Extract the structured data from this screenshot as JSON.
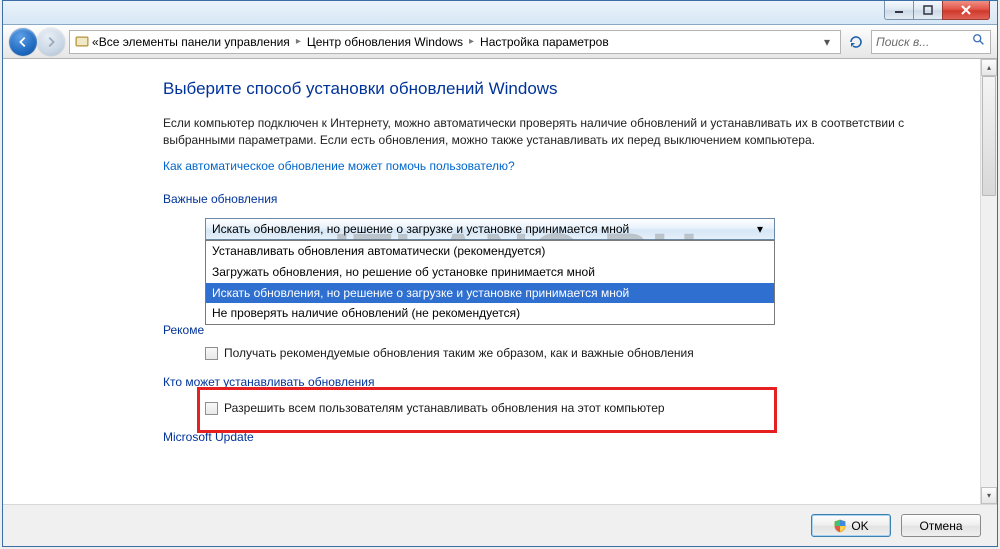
{
  "watermark": "ITLANG.RU",
  "breadcrumb": {
    "prefix": "«",
    "items": [
      "Все элементы панели управления",
      "Центр обновления Windows",
      "Настройка параметров"
    ]
  },
  "search": {
    "placeholder": "Поиск в..."
  },
  "page": {
    "title": "Выберите способ установки обновлений Windows",
    "intro": "Если компьютер подключен к Интернету, можно автоматически проверять наличие обновлений и устанавливать их в соответствии с выбранными параметрами. Если есть обновления, можно также устанавливать их перед выключением компьютера.",
    "help_link": "Как автоматическое обновление может помочь пользователю?"
  },
  "important": {
    "label": "Важные обновления",
    "selected": "Искать обновления, но решение о загрузке и установке принимается мной",
    "options": [
      "Устанавливать обновления автоматически (рекомендуется)",
      "Загружать обновления, но решение об установке принимается мной",
      "Искать обновления, но решение о загрузке и установке принимается мной",
      "Не проверять наличие обновлений (не рекомендуется)"
    ],
    "selected_index": 2
  },
  "recommended": {
    "label": "Рекоме",
    "checkbox": "Получать рекомендуемые обновления таким же образом, как и важные обновления"
  },
  "who": {
    "label": "Кто может устанавливать обновления",
    "checkbox": "Разрешить всем пользователям устанавливать обновления на этот компьютер"
  },
  "ms_update": {
    "label": "Microsoft Update"
  },
  "buttons": {
    "ok": "OK",
    "cancel": "Отмена"
  }
}
